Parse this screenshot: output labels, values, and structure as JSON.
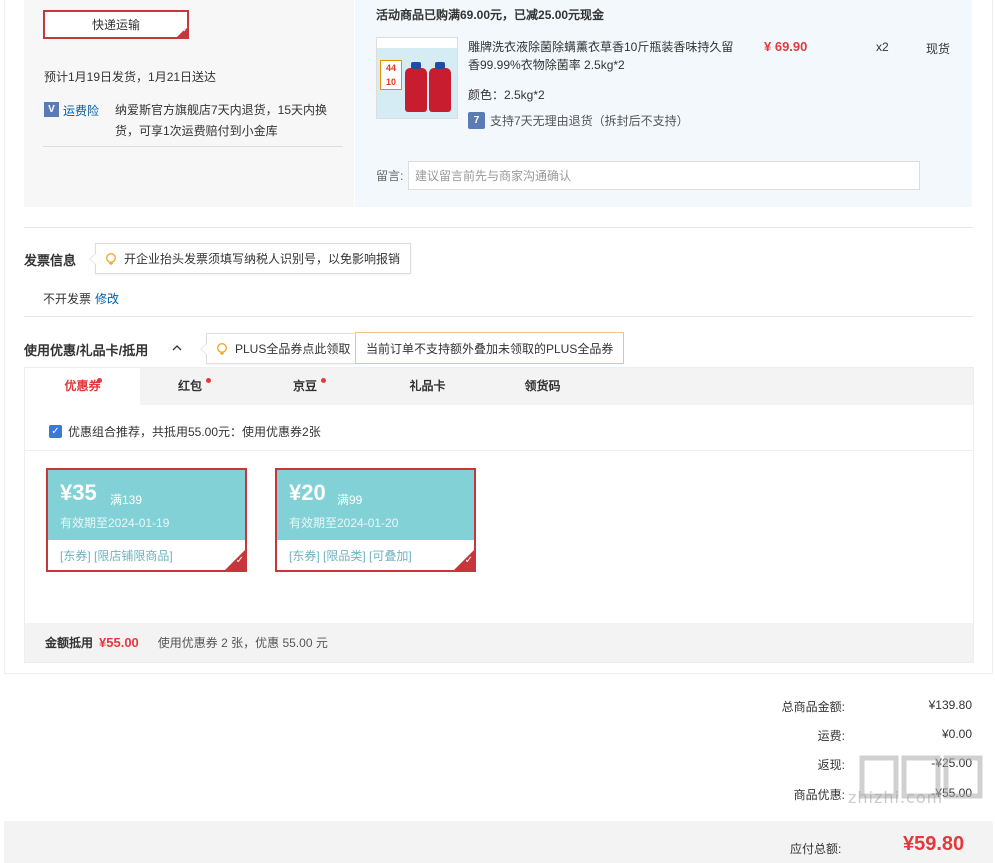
{
  "shipping": {
    "method": "快递运输",
    "eta": "预计1月19日发货，1月21日送达",
    "insurance_icon": "V",
    "insurance_label": "运费险",
    "insurance_desc": "纳爱斯官方旗舰店7天内退货，15天内换货，可享1次运费赔付到小金库"
  },
  "product": {
    "promo": "活动商品已购满69.00元，已减25.00元现金",
    "name": "雕牌洗衣液除菌除螨薰衣草香10斤瓶装香味持久留香99.99%衣物除菌率 2.5kg*2",
    "price": "¥ 69.90",
    "qty": "x2",
    "stock": "现货",
    "color": "颜色：2.5kg*2",
    "return_icon": "7",
    "return_policy": "支持7天无理由退货（拆封后不支持）",
    "image_badge": "44",
    "image_badge_sub": "10"
  },
  "message": {
    "label": "留言:",
    "placeholder": "建议留言前先与商家沟通确认"
  },
  "invoice": {
    "title": "发票信息",
    "tip": "开企业抬头发票须填写纳税人识别号，以免影响报销",
    "value": "不开发票",
    "edit": "修改"
  },
  "coupons": {
    "title": "使用优惠/礼品卡/抵用",
    "plus_tip": "PLUS全品券点此领取",
    "plus_warn": "当前订单不支持额外叠加未领取的PLUS全品券",
    "tabs": [
      {
        "label": "优惠券",
        "dot": true
      },
      {
        "label": "红包",
        "dot": true
      },
      {
        "label": "京豆",
        "dot": true
      },
      {
        "label": "礼品卡",
        "dot": false
      },
      {
        "label": "领货码",
        "dot": false
      }
    ],
    "combo": "优惠组合推荐，共抵用55.00元：使用优惠券2张",
    "items": [
      {
        "amount": "¥35",
        "condition": "满139",
        "expiry": "有效期至2024-01-19",
        "tags": "[东券]  [限店铺限商品]"
      },
      {
        "amount": "¥20",
        "condition": "满99",
        "expiry": "有效期至2024-01-20",
        "tags": "[东券]  [限品类]  [可叠加]"
      }
    ],
    "total_label": "金额抵用",
    "total_amount": "¥55.00",
    "total_desc": "使用优惠券 2 张，优惠 55.00 元"
  },
  "summary": {
    "rows": [
      {
        "label": "总商品金额:",
        "value": "¥139.80"
      },
      {
        "label": "运费:",
        "value": "¥0.00"
      },
      {
        "label": "返现:",
        "value": "-¥25.00"
      },
      {
        "label": "商品优惠:",
        "value": "-¥55.00"
      }
    ],
    "pay_label": "应付总额:",
    "pay_amount": "¥59.80"
  },
  "watermark": {
    "text": "zhizhi.com"
  },
  "colors": {
    "accent": "#e4393c",
    "coupon": "#82d1d6",
    "link": "#005ea7"
  }
}
